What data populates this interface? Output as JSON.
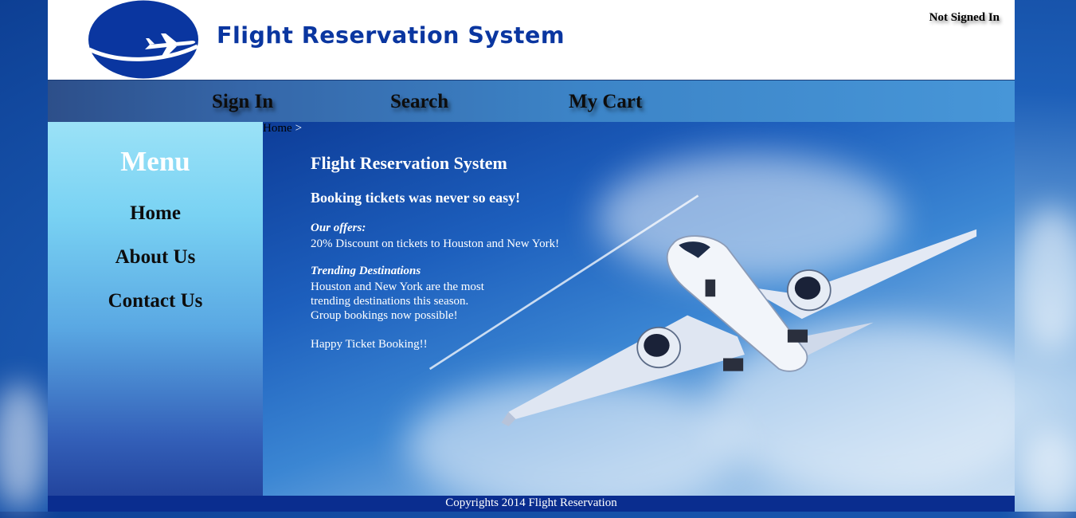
{
  "header": {
    "site_title": "Flight Reservation System",
    "status": "Not Signed In",
    "logo_icon": "airplane-logo-icon"
  },
  "nav": {
    "items": [
      "Sign In",
      "Search",
      "My Cart"
    ]
  },
  "sidebar": {
    "title": "Menu",
    "items": [
      "Home",
      "About Us",
      "Contact Us"
    ]
  },
  "breadcrumb": {
    "home": "Home",
    "separator": ">"
  },
  "main": {
    "heading": "Flight Reservation System",
    "tagline": "Booking tickets was never so easy!",
    "offers_title": "Our offers:",
    "offers_text": "20% Discount on tickets to Houston and New York!",
    "trending_title": "Trending Destinations",
    "trending_lines": [
      "Houston and New York are the most",
      "trending destinations this season.",
      "Group bookings now possible!"
    ],
    "closing": "Happy Ticket Booking!!"
  },
  "footer": {
    "copyright": "Copyrights 2014 Flight Reservation"
  },
  "colors": {
    "brand_blue": "#0a36a0",
    "nav_bg": "#3c84c7",
    "footer_bg": "#0a2d8f",
    "header_bg": "#ffffff"
  }
}
